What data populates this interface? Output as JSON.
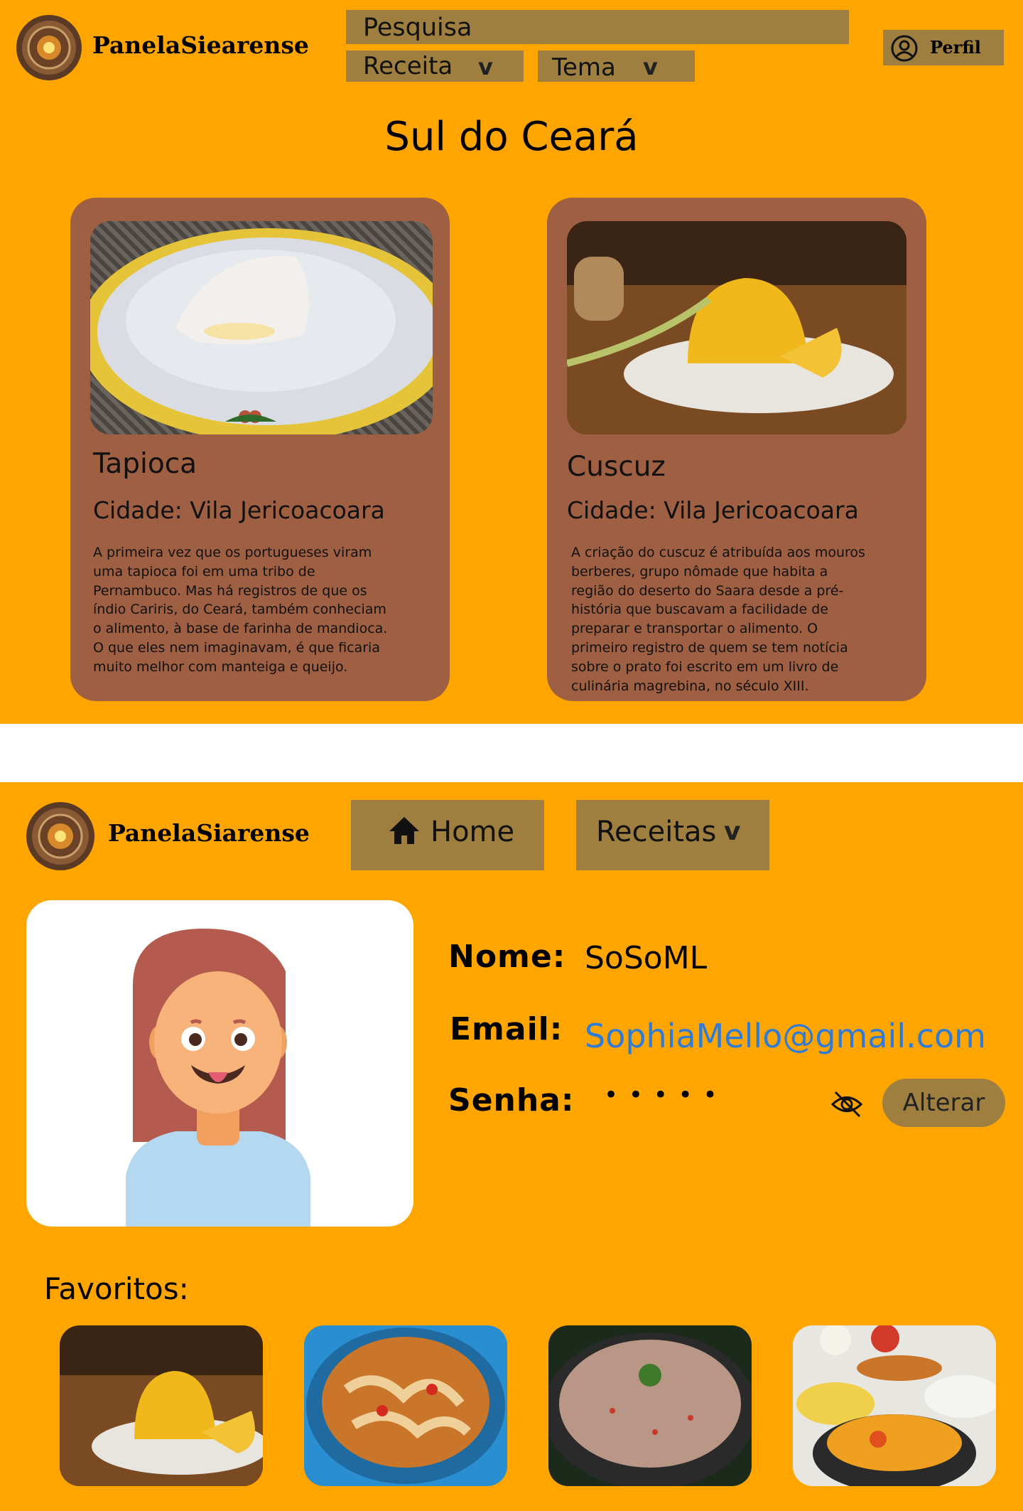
{
  "top": {
    "brand": "PanelaSiearense",
    "search_placeholder": "Pesquisa",
    "filter_recipe": "Receita",
    "filter_theme": "Tema",
    "chevron": "v",
    "profile_label": "Perfil",
    "page_title": "Sul do Ceará",
    "cards": [
      {
        "name": "Tapioca",
        "city": "Cidade: Vila Jericoacoara",
        "description": [
          "A primeira vez que os portugueses viram",
          "uma tapioca foi em uma tribo de",
          "Pernambuco. Mas há registros de que os",
          "índio Cariris, do Ceará, também conheciam",
          "o alimento, à base de farinha de mandioca.",
          "O que eles nem imaginavam, é que ficaria",
          "muito melhor com manteiga e queijo."
        ]
      },
      {
        "name": "Cuscuz",
        "city": "Cidade: Vila Jericoacoara",
        "description": [
          "A criação do cuscuz é atribuída aos mouros",
          "berberes, grupo nômade que habita a",
          "região do deserto do Saara desde a pré-",
          "história que buscavam a facilidade de",
          "preparar e transportar o alimento. O",
          "primeiro registro de quem se tem notícia",
          "sobre o prato foi escrito em um livro de",
          "culinária magrebina, no século XIII."
        ]
      }
    ]
  },
  "profile": {
    "brand": "PanelaSiarense",
    "nav_home": "Home",
    "nav_recipes": "Receitas",
    "chevron": "v",
    "name_label": "Nome:",
    "name_value": "SoSoML",
    "email_label": "Email:",
    "email_value": "SophiaMello@gmail.com",
    "password_label": "Senha:",
    "password_mask": "•   •   •   •   •",
    "change_button": "Alterar",
    "favorites_title": "Favoritos:"
  },
  "colors": {
    "background": "#FFA500",
    "button": "#9E7F3F",
    "card": "#9E5F42",
    "link": "#2F7BD8"
  },
  "icons": {
    "profile": "user-circle-icon",
    "home": "home-icon",
    "password_visibility": "eye-off-icon",
    "logo": "clay-pot-logo-icon"
  }
}
